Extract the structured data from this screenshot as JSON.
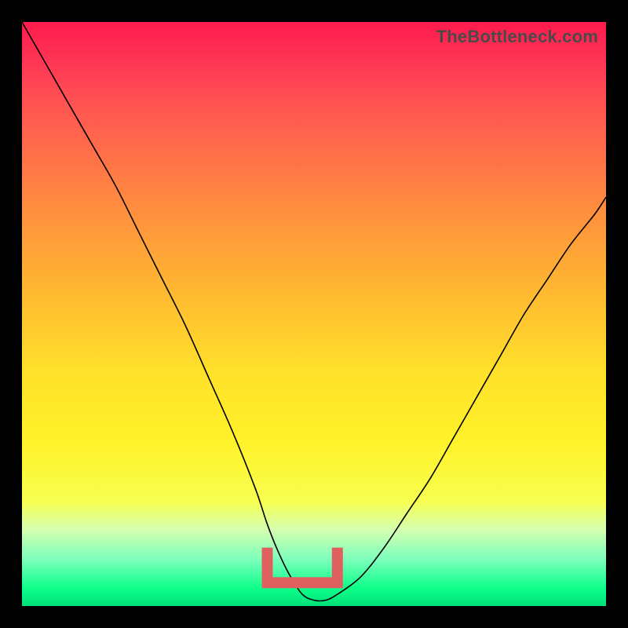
{
  "watermark": "TheBottleneck.com",
  "colors": {
    "frame": "#000000",
    "curve": "#000000",
    "bracket": "#e06060",
    "gradient_top": "#ff1a4d",
    "gradient_mid": "#ffe12a",
    "gradient_bottom": "#00e079"
  },
  "chart_data": {
    "type": "line",
    "title": "",
    "xlabel": "",
    "ylabel": "",
    "xlim": [
      0,
      100
    ],
    "ylim": [
      0,
      100
    ],
    "series": [
      {
        "name": "curve",
        "x": [
          0,
          4,
          8,
          12,
          16,
          20,
          24,
          28,
          32,
          36,
          40,
          42,
          44,
          46,
          48,
          50,
          52,
          54,
          58,
          62,
          66,
          70,
          74,
          78,
          82,
          86,
          90,
          94,
          98,
          100
        ],
        "values": [
          100,
          93,
          86,
          79,
          72,
          64,
          56,
          48,
          39,
          30,
          20,
          14,
          9,
          5,
          2,
          1,
          1,
          2,
          5,
          10,
          16,
          22,
          29,
          36,
          43,
          50,
          56,
          62,
          67,
          70
        ]
      }
    ],
    "annotations": [
      {
        "name": "optimal-bracket",
        "shape": "staple",
        "x_start": 42,
        "x_end": 54,
        "y": 4,
        "height": 6
      }
    ]
  }
}
